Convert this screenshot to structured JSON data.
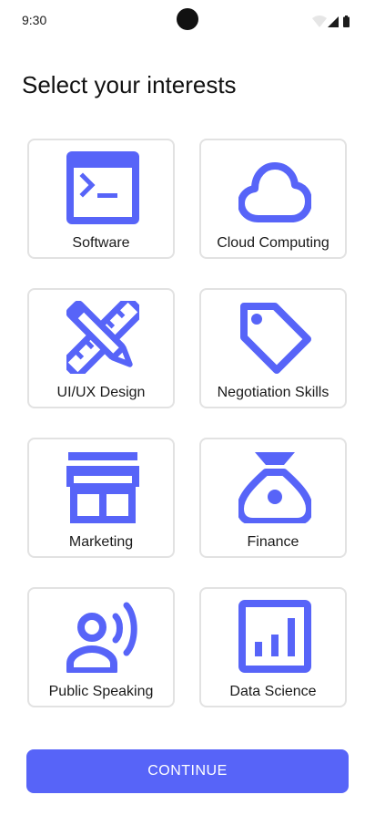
{
  "status_bar": {
    "time": "9:30",
    "icons": [
      "wifi-icon",
      "signal-icon",
      "battery-icon"
    ]
  },
  "title": "Select your interests",
  "accent_color": "#5764f8",
  "interests": [
    {
      "label": "Software",
      "icon": "terminal-icon"
    },
    {
      "label": "Cloud Computing",
      "icon": "cloud-icon"
    },
    {
      "label": "UI/UX Design",
      "icon": "design-tools-icon"
    },
    {
      "label": "Negotiation Skills",
      "icon": "tag-icon"
    },
    {
      "label": "Marketing",
      "icon": "storefront-icon"
    },
    {
      "label": "Finance",
      "icon": "money-bag-icon"
    },
    {
      "label": "Public Speaking",
      "icon": "speaker-icon"
    },
    {
      "label": "Data Science",
      "icon": "analytics-icon"
    }
  ],
  "continue_label": "CONTINUE"
}
